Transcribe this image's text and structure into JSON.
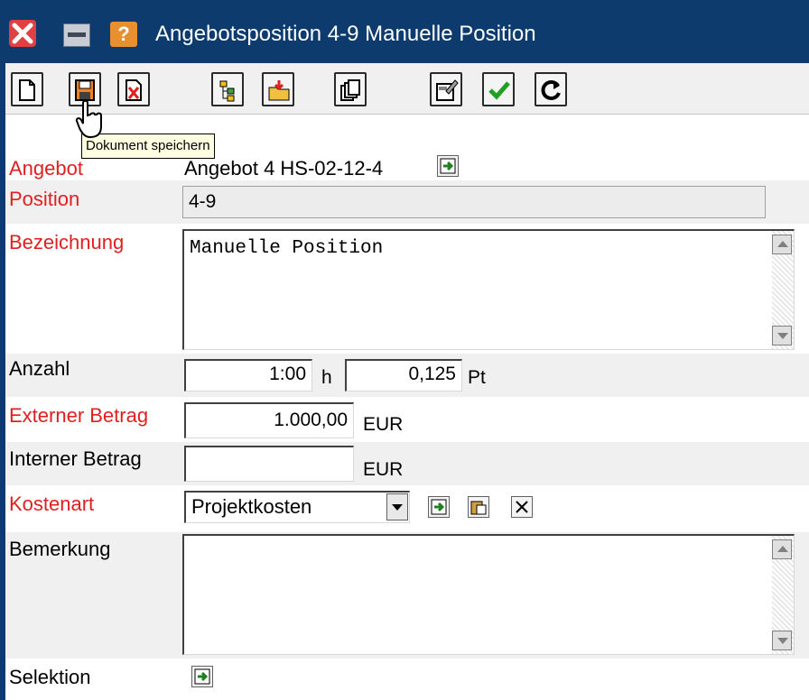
{
  "window": {
    "title": "Angebotsposition 4-9 Manuelle Position"
  },
  "tooltip": {
    "text": "Dokument speichern"
  },
  "toolbar": {
    "buttons": [
      "new-document",
      "save-document",
      "delete-document",
      "tree",
      "open-folder",
      "copy",
      "edit",
      "confirm",
      "refresh"
    ]
  },
  "form": {
    "angebot": {
      "label": "Angebot",
      "value": "Angebot 4 HS-02-12-4"
    },
    "position": {
      "label": "Position",
      "value": "4-9"
    },
    "bezeichnung": {
      "label": "Bezeichnung",
      "value": "Manuelle Position"
    },
    "anzahl": {
      "label": "Anzahl",
      "value_time": "1:00",
      "unit_time": "h",
      "value_pt": "0,125",
      "unit_pt": "Pt"
    },
    "externer_betrag": {
      "label": "Externer Betrag",
      "value": "1.000,00",
      "currency": "EUR"
    },
    "interner_betrag": {
      "label": "Interner Betrag",
      "value": "",
      "currency": "EUR"
    },
    "kostenart": {
      "label": "Kostenart",
      "selected": "Projektkosten"
    },
    "bemerkung": {
      "label": "Bemerkung",
      "value": ""
    },
    "selektion": {
      "label": "Selektion"
    }
  },
  "colors": {
    "titlebar": "#0d3b6e",
    "required_label": "#e02020",
    "row_shade": "#f0f0f0"
  }
}
